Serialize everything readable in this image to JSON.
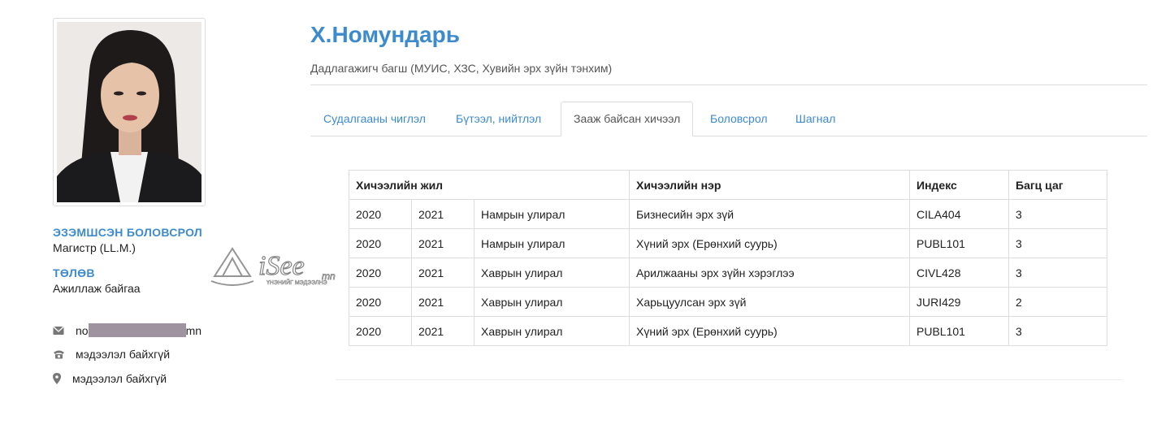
{
  "profile": {
    "name": "Х.Номундарь",
    "position": "Дадлагажигч багш (МУИС, ХЗС, Хувийн эрх зүйн тэнхим)"
  },
  "sidebar": {
    "education_heading": "ЭЗЭМШСЭН БОЛОВСРОЛ",
    "education_value": "Магистр (LL.M.)",
    "status_heading": "ТӨЛӨВ",
    "status_value": "Ажиллаж байгаа",
    "email_prefix": "no",
    "email_suffix": "mn",
    "phone": "мэдээлэл байхгүй",
    "address": "мэдээлэл байхгүй"
  },
  "watermark": {
    "brand": "iSee",
    "tld": "mn",
    "tagline": "ҮНЭНИЙГ МЭДЭЭЛНЭ"
  },
  "tabs": [
    {
      "label": "Судалгааны чиглэл",
      "active": false
    },
    {
      "label": "Бүтээл, нийтлэл",
      "active": false
    },
    {
      "label": "Зааж байсан хичээл",
      "active": true
    },
    {
      "label": "Боловсрол",
      "active": false
    },
    {
      "label": "Шагнал",
      "active": false
    }
  ],
  "table": {
    "headers": {
      "year": "Хичээлийн жил",
      "course_name": "Хичээлийн нэр",
      "index": "Индекс",
      "credit": "Багц цаг"
    },
    "rows": [
      {
        "y1": "2020",
        "y2": "2021",
        "term": "Намрын улирал",
        "name": "Бизнесийн эрх зүй",
        "index": "CILA404",
        "credit": "3"
      },
      {
        "y1": "2020",
        "y2": "2021",
        "term": "Намрын улирал",
        "name": "Хүний эрх (Ерөнхий суурь)",
        "index": "PUBL101",
        "credit": "3"
      },
      {
        "y1": "2020",
        "y2": "2021",
        "term": "Хаврын улирал",
        "name": "Арилжааны эрх зүйн хэрэглээ",
        "index": "CIVL428",
        "credit": "3"
      },
      {
        "y1": "2020",
        "y2": "2021",
        "term": "Хаврын улирал",
        "name": "Харьцуулсан эрх зүй",
        "index": "JURI429",
        "credit": "2"
      },
      {
        "y1": "2020",
        "y2": "2021",
        "term": "Хаврын улирал",
        "name": "Хүний эрх (Ерөнхий суурь)",
        "index": "PUBL101",
        "credit": "3"
      }
    ]
  }
}
